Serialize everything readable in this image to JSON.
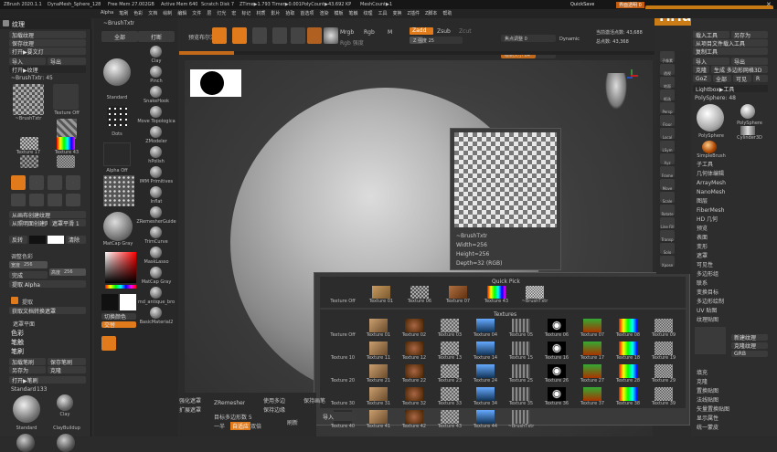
{
  "titlebar": {
    "app": "ZBrush 2020.1.1",
    "items": [
      "DynaMesh_Sphere_128",
      "Free Mem 27.002GB",
      "Active Mem 640",
      "Scratch Disk 7",
      "ZTime▶1.793 Timer▶0.001",
      "PolyCount▶43.692 KP",
      "MeshCount▶1"
    ],
    "quicksave": "QuickSave",
    "transparency": "界面透明 0",
    "watermark": "YiHuu.com"
  },
  "menubar": {
    "items": [
      "Alpha",
      "笔刷",
      "色彩",
      "文档",
      "绘制",
      "编辑",
      "文件",
      "层",
      "灯光",
      "宏",
      "标记",
      "材质",
      "影片",
      "拾取",
      "首选项",
      "渲染",
      "模板",
      "笔触",
      "纹理",
      "工具",
      "变换",
      "Z插件",
      "Z脚本",
      "帮助"
    ]
  },
  "texture_panel": {
    "title": "纹理",
    "top_buttons": [
      "加载纹理",
      "保存纹理",
      "打开▶要文灯"
    ],
    "import_label": "导入",
    "export_label": "导出",
    "brush_txtr_label": "~BrushTxtr: 45",
    "textures": [
      "~BrushTxtr",
      "Texture Off",
      "Texture 05",
      "Texture 17",
      "Texture 43",
      "Texture 05",
      "Texture 05"
    ],
    "from_spotlight": "从画布创建纹理",
    "create": "从照明面创建网格",
    "inverse": "反转",
    "spotlight_toggle": "遮罩平滑 1",
    "sliders": [
      {
        "name": "宽度",
        "value": "256"
      },
      {
        "name": "高度",
        "value": "256"
      }
    ],
    "cd": "完成",
    "pick": "提取 Alpha",
    "paint": "提取",
    "color_label": "调整色彩",
    "mask_label": "遮罩平面",
    "sections": [
      "色彩",
      "笔触",
      "笔刷"
    ],
    "brush_sub": [
      "加载笔刷",
      "保存笔刷",
      "另存为",
      "克隆",
      "选择笔刷"
    ],
    "standard_label": "Standard",
    "standard_value": "133"
  },
  "toolbox": {
    "left_labels": [
      "全部",
      "打断"
    ],
    "brushes": [
      "Standard",
      "Dots",
      "Alpha Off",
      "MatCap Gray"
    ],
    "col2": [
      "Clay",
      "Pinch",
      "SnakeHook",
      "Move Topologica",
      "ZModeler",
      "hPolish",
      "IMM Primitives",
      "Inflat",
      "ZRemesherGuide",
      "TrimCurve",
      "MaskLasso",
      "MatCap Gray",
      "md_antique_bro",
      "BasicMaterial2"
    ],
    "switch_color": "切换颜色",
    "alt_color": "交替",
    "clay_lower": [
      "Clay",
      "ClayBuildup",
      "Move",
      "hPolish"
    ],
    "zremesher": "ZRemesher",
    "footer": [
      "强化遮罩",
      "扩展遮罩",
      "目标多边形数 5",
      "一半",
      "自适应",
      "双倍",
      "使用多边",
      "保持边缘",
      "保持画笔",
      "刷新"
    ]
  },
  "canvas_top": {
    "render": "预览布尔渲染",
    "draw": "Draw",
    "move": "Move",
    "scale": "Scale",
    "rotate": "Rotate",
    "mrgb": "Mrgb",
    "rgb": "Rgb",
    "m": "M",
    "zadd": "Zadd",
    "zsub": "Zsub",
    "zcut": "Zcut",
    "rgb_intensity": "Rgb 强度",
    "z_intensity": "Z 强度 25",
    "focal_shift": "焦点调整 0",
    "draw_size": "绘制大小 64",
    "dynamic": "Dynamic",
    "active_points": "当前激活点数: 43,688",
    "total_points": "总点数: 43,368"
  },
  "tooltip": {
    "name": "~BrushTxtr",
    "width": "Width=256",
    "height": "Height=256",
    "depth": "Depth=32 (RGB)"
  },
  "quickpick": {
    "title": "Quick Pick",
    "items": [
      "Texture Off",
      "Texture 01",
      "Texture 06",
      "Texture 07",
      "Texture 43",
      "~BrushTxtr"
    ]
  },
  "textures": {
    "title": "Textures",
    "items": [
      "Texture Off",
      "Texture 01",
      "Texture 02",
      "Texture 03",
      "Texture 04",
      "Texture 05",
      "Texture 06",
      "Texture 07",
      "Texture 08",
      "Texture 09",
      "Texture 10",
      "Texture 11",
      "Texture 12",
      "Texture 13",
      "Texture 14",
      "Texture 15",
      "Texture 16",
      "Texture 17",
      "Texture 18",
      "Texture 19",
      "Texture 20",
      "Texture 21",
      "Texture 22",
      "Texture 23",
      "Texture 24",
      "Texture 25",
      "Texture 26",
      "Texture 27",
      "Texture 28",
      "Texture 29",
      "Texture 30",
      "Texture 31",
      "Texture 32",
      "Texture 33",
      "Texture 34",
      "Texture 35",
      "Texture 36",
      "Texture 37",
      "Texture 38",
      "Texture 39",
      "Texture 40",
      "Texture 41",
      "Texture 42",
      "Texture 43",
      "Texture 44",
      "~BrushTxtr"
    ],
    "import": "导入"
  },
  "right_shelf": {
    "labels": [
      "子像素",
      "透视",
      "地面",
      "框选",
      "Persp",
      "Floor",
      "Local",
      "LSym",
      "Xyz",
      "Frame",
      "Move",
      "Scale",
      "Rotate",
      "Line Fill",
      "Transp",
      "Solo",
      "Xpose"
    ]
  },
  "tool_panel": {
    "top": [
      "载入工具",
      "另存为",
      "从项目文件载入工具",
      "复制工具",
      "导入",
      "导出",
      "克隆",
      "生成 多边形网格3D",
      "GoZ",
      "全部",
      "可见",
      "R"
    ],
    "lightbox": "Lightbox▶工具",
    "polysphere": "PolySphere: 48",
    "tools": [
      "PolySphere",
      "PolySphere",
      "Cylinder3D",
      "SimpleBrush"
    ],
    "items": [
      "子工具",
      "几何体编辑",
      "ArrayMesh",
      "NanoMesh",
      "图层",
      "FiberMesh",
      "HD 几何",
      "预览",
      "表面",
      "变形",
      "遮罩",
      "可见性",
      "多边形组",
      "联系",
      "变换目标",
      "多边形绘制",
      "UV 贴图",
      "纹理贴图"
    ],
    "sub": [
      "新建纹理",
      "克隆纹理",
      "GRB"
    ],
    "bottom": [
      "填充",
      "克隆",
      "置换贴图",
      "法线贴图",
      "矢量置换贴图",
      "显示属性",
      "统一蒙皮"
    ]
  }
}
